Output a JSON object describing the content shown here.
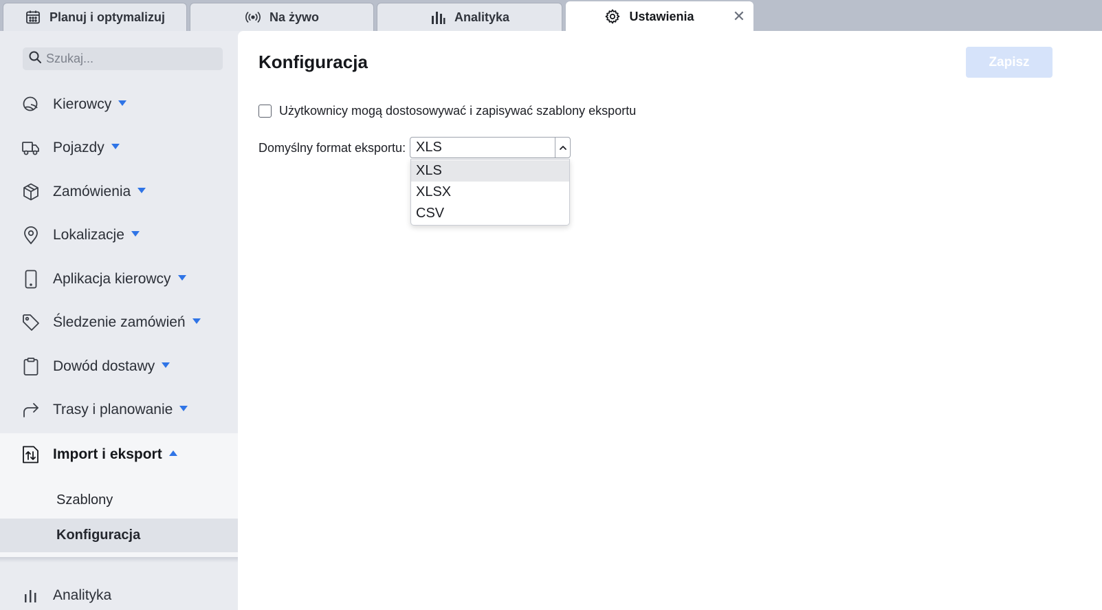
{
  "tabs": [
    {
      "label": "Planuj i optymalizuj",
      "icon": "calendar-icon"
    },
    {
      "label": "Na żywo",
      "icon": "broadcast-icon"
    },
    {
      "label": "Analityka",
      "icon": "bar-chart-icon"
    },
    {
      "label": "Ustawienia",
      "icon": "gear-icon",
      "active": true
    }
  ],
  "sidebar": {
    "search_placeholder": "Szukaj...",
    "items": [
      {
        "label": "Kierowcy",
        "icon": "driver-icon"
      },
      {
        "label": "Pojazdy",
        "icon": "truck-icon"
      },
      {
        "label": "Zamówienia",
        "icon": "package-icon"
      },
      {
        "label": "Lokalizacje",
        "icon": "map-pin-icon"
      },
      {
        "label": "Aplikacja kierowcy",
        "icon": "phone-icon"
      },
      {
        "label": "Śledzenie zamówień",
        "icon": "tag-icon"
      },
      {
        "label": "Dowód dostawy",
        "icon": "clipboard-icon"
      },
      {
        "label": "Trasy i planowanie",
        "icon": "route-arrow-icon"
      },
      {
        "label": "Import i eksport",
        "icon": "import-export-icon",
        "expanded": true
      }
    ],
    "subitems": [
      {
        "label": "Szablony"
      },
      {
        "label": "Konfiguracja",
        "active": true
      }
    ],
    "bottom_item": {
      "label": "Analityka",
      "icon": "bar-chart-icon"
    }
  },
  "main": {
    "title": "Konfiguracja",
    "save_label": "Zapisz",
    "checkbox_label": "Użytkownicy mogą dostosowywać i zapisywać szablony eksportu",
    "checkbox_checked": false,
    "format_label": "Domyślny format eksportu:",
    "format_value": "XLS",
    "format_options": [
      "XLS",
      "XLSX",
      "CSV"
    ],
    "highlighted_option": "XLS"
  },
  "colors": {
    "accent": "#2f74e6",
    "save_disabled": "#d6e3fa",
    "sidebar_bg": "#e9ebf0"
  }
}
